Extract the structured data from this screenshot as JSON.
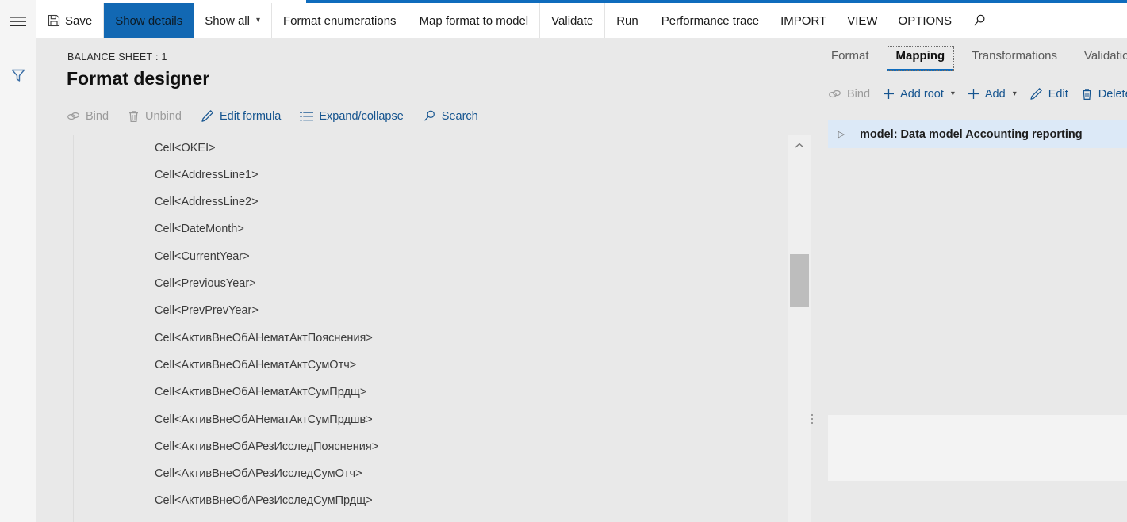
{
  "theme": {
    "accent": "#0f6cbd",
    "active_button_bg": "#1268b3",
    "link_blue": "#15548f",
    "disabled_gray": "#9b9b9b",
    "content_bg": "#e9e9e9",
    "selected_row_bg": "#dce9f7"
  },
  "rail": {
    "menu_icon": "hamburger-icon",
    "filter_icon": "filter-funnel-icon"
  },
  "commandbar": {
    "items": [
      {
        "label": "Save",
        "icon": "save-disk-icon",
        "state": "normal",
        "has_chevron": false
      },
      {
        "label": "Show details",
        "icon": null,
        "state": "active",
        "has_chevron": false
      },
      {
        "label": "Show all",
        "icon": null,
        "state": "normal",
        "has_chevron": true
      },
      {
        "label": "Format enumerations",
        "icon": null,
        "state": "normal",
        "has_chevron": false
      },
      {
        "label": "Map format to model",
        "icon": null,
        "state": "normal",
        "has_chevron": false
      },
      {
        "label": "Validate",
        "icon": null,
        "state": "normal",
        "has_chevron": false
      },
      {
        "label": "Run",
        "icon": null,
        "state": "normal",
        "has_chevron": false
      },
      {
        "label": "Performance trace",
        "icon": null,
        "state": "normal",
        "has_chevron": false
      },
      {
        "label": "IMPORT",
        "icon": null,
        "state": "normal",
        "has_chevron": false
      },
      {
        "label": "VIEW",
        "icon": null,
        "state": "normal",
        "has_chevron": false
      },
      {
        "label": "OPTIONS",
        "icon": null,
        "state": "normal",
        "has_chevron": false
      }
    ],
    "search_icon": "search-magnifier-icon"
  },
  "header": {
    "breadcrumb": "BALANCE SHEET : 1",
    "title": "Format designer"
  },
  "left_pane": {
    "actions": [
      {
        "label": "Bind",
        "icon": "link-chain-icon",
        "enabled": false
      },
      {
        "label": "Unbind",
        "icon": "trash-icon",
        "enabled": false
      },
      {
        "label": "Edit formula",
        "icon": "pencil-icon",
        "enabled": true
      },
      {
        "label": "Expand/collapse",
        "icon": "list-lines-icon",
        "enabled": true
      },
      {
        "label": "Search",
        "icon": "search-magnifier-icon",
        "enabled": true
      }
    ],
    "tree_rows": [
      "Cell<OKEI>",
      "Cell<AddressLine1>",
      "Cell<AddressLine2>",
      "Cell<DateMonth>",
      "Cell<CurrentYear>",
      "Cell<PreviousYear>",
      "Cell<PrevPrevYear>",
      "Cell<АктивВнеОбАНематАктПояснения>",
      "Cell<АктивВнеОбАНематАктСумОтч>",
      "Cell<АктивВнеОбАНематАктСумПрдщ>",
      "Cell<АктивВнеОбАНематАктСумПрдшв>",
      "Cell<АктивВнеОбАРезИсследПояснения>",
      "Cell<АктивВнеОбАРезИсследСумОтч>",
      "Cell<АктивВнеОбАРезИсследСумПрдщ>"
    ],
    "scrollbar": {
      "up_arrow_icon": "chevron-up-icon",
      "thumb_position_pct": 27,
      "thumb_size_pct": 14
    },
    "splitter_icon": "drag-grip-dots-icon"
  },
  "right_pane": {
    "tabs": [
      {
        "label": "Format",
        "selected": false
      },
      {
        "label": "Mapping",
        "selected": true
      },
      {
        "label": "Transformations",
        "selected": false
      },
      {
        "label": "Validations",
        "selected": false
      }
    ],
    "actions": [
      {
        "label": "Bind",
        "icon": "link-chain-icon",
        "enabled": false,
        "has_chevron": false
      },
      {
        "label": "Add root",
        "icon": "plus-icon",
        "enabled": true,
        "has_chevron": true
      },
      {
        "label": "Add",
        "icon": "plus-icon",
        "enabled": true,
        "has_chevron": true
      },
      {
        "label": "Edit",
        "icon": "pencil-icon",
        "enabled": true,
        "has_chevron": false
      },
      {
        "label": "Delete",
        "icon": "trash-icon",
        "enabled": true,
        "has_chevron": false
      }
    ],
    "tree": {
      "expander_glyph": "▷",
      "root_label": "model: Data model Accounting reporting",
      "selected": true
    }
  }
}
